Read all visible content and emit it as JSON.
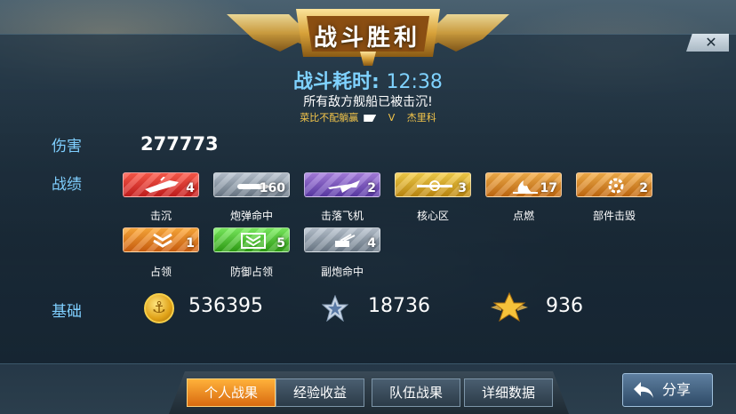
{
  "header": {
    "title": "战斗胜利",
    "close_label": "✕"
  },
  "battle": {
    "time_label": "战斗耗时:",
    "time_value": "12:38",
    "result": "所有敌方舰船已被击沉!",
    "player": "菜比不配躺赢",
    "vs": "V",
    "opponent": "杰里科"
  },
  "stats": {
    "damage_label": "伤害",
    "damage_value": "277773",
    "record_label": "战绩",
    "base_label": "基础",
    "medals": [
      {
        "label": "击沉",
        "count": "4",
        "color": "#d83a2e",
        "icon": "ship-sinking-icon"
      },
      {
        "label": "炮弹命中",
        "count": "160",
        "color": "#8a98a6",
        "icon": "shell-icon"
      },
      {
        "label": "击落飞机",
        "count": "2",
        "color": "#7a52c4",
        "icon": "plane-down-icon"
      },
      {
        "label": "核心区",
        "count": "3",
        "color": "#dba820",
        "icon": "core-zone-icon"
      },
      {
        "label": "点燃",
        "count": "17",
        "color": "#e29a28",
        "icon": "fire-icon"
      },
      {
        "label": "部件击毁",
        "count": "2",
        "color": "#e29a28",
        "icon": "gear-broken-icon"
      },
      {
        "label": "占领",
        "count": "1",
        "color": "#e5801e",
        "icon": "chevron-double-icon"
      },
      {
        "label": "防御占领",
        "count": "5",
        "color": "#4cc42e",
        "icon": "shield-chevron-icon"
      },
      {
        "label": "副炮命中",
        "count": "4",
        "color": "#8a98a6",
        "icon": "secondary-gun-icon"
      }
    ],
    "resources": [
      {
        "icon": "gold-coin-icon",
        "value": "536395"
      },
      {
        "icon": "silver-star-icon",
        "value": "18736"
      },
      {
        "icon": "gold-star-icon",
        "value": "936"
      }
    ]
  },
  "tabs": [
    {
      "label": "个人战果",
      "active": true
    },
    {
      "label": "经验收益",
      "active": false
    },
    {
      "label": "队伍战果",
      "active": false
    },
    {
      "label": "详细数据",
      "active": false
    }
  ],
  "share": {
    "label": "分享"
  },
  "colors": {
    "accent_blue": "#7fd2ff",
    "accent_orange": "#e8801e",
    "gold": "#f5c64a"
  }
}
